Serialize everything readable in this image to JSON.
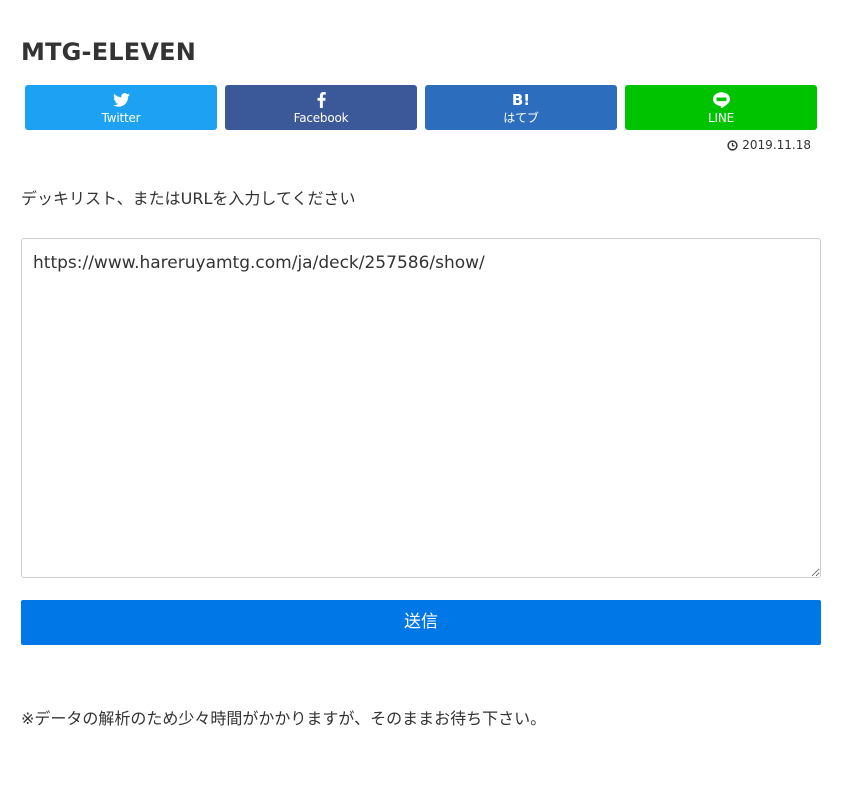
{
  "page": {
    "title": "MTG-ELEVEN",
    "date": "2019.11.18"
  },
  "share": {
    "twitter": {
      "label": "Twitter",
      "icon": "twitter-bird-icon",
      "color": "#1da1f2"
    },
    "facebook": {
      "label": "Facebook",
      "icon": "facebook-f-icon",
      "color": "#3b5998"
    },
    "hatena": {
      "label": "はてブ",
      "glyph": "B!",
      "icon": "hatena-bookmark-icon",
      "color": "#2c6ebd"
    },
    "line": {
      "label": "LINE",
      "icon": "line-chat-bubble-icon",
      "color": "#00c300"
    }
  },
  "form": {
    "prompt": "デッキリスト、またはURLを入力してください",
    "deck_input_value": "https://www.hareruyamtg.com/ja/deck/257586/show/",
    "submit_label": "送信",
    "submit_color": "#0077e6"
  },
  "notice": "※データの解析のため少々時間がかかりますが、そのままお待ち下さい。"
}
